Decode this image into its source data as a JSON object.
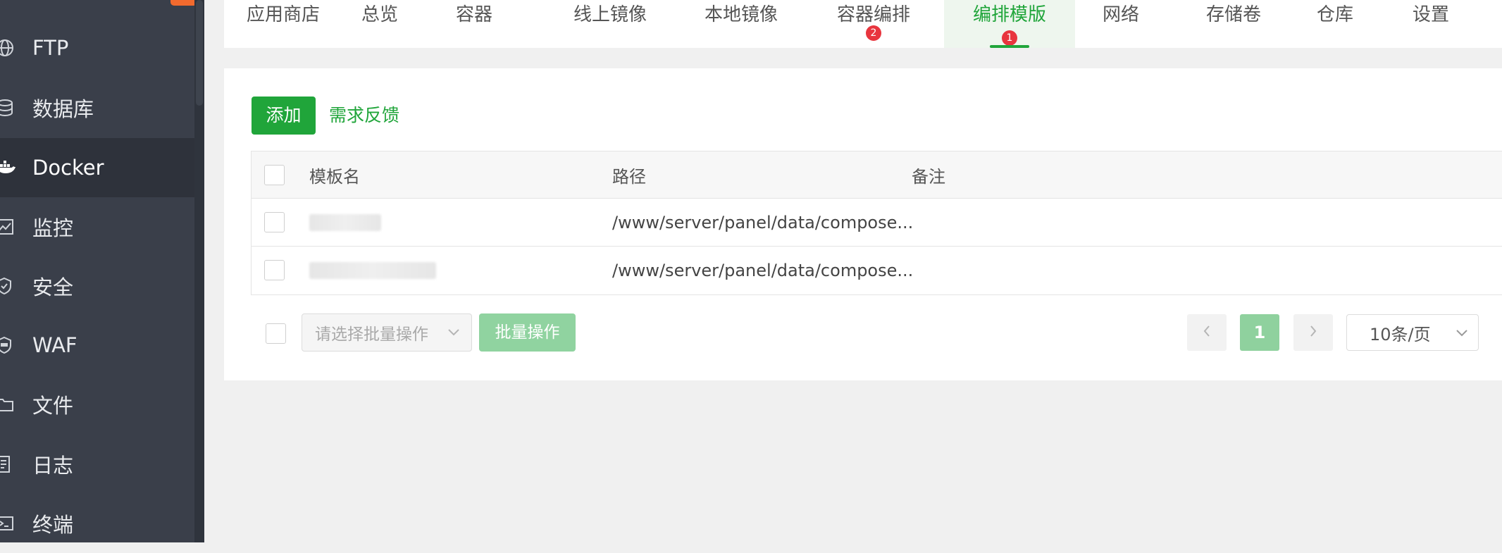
{
  "sidebar": {
    "items": [
      {
        "label": "FTP",
        "icon": "globe-icon"
      },
      {
        "label": "数据库",
        "icon": "database-icon"
      },
      {
        "label": "Docker",
        "icon": "docker-icon",
        "active": true
      },
      {
        "label": "监控",
        "icon": "monitor-chart-icon"
      },
      {
        "label": "安全",
        "icon": "shield-icon"
      },
      {
        "label": "WAF",
        "icon": "waf-shield-icon"
      },
      {
        "label": "文件",
        "icon": "folder-icon"
      },
      {
        "label": "日志",
        "icon": "log-icon"
      },
      {
        "label": "终端",
        "icon": "terminal-icon"
      }
    ]
  },
  "tabs": [
    {
      "label": "应用商店"
    },
    {
      "label": "总览"
    },
    {
      "label": "容器"
    },
    {
      "label": "线上镜像"
    },
    {
      "label": "本地镜像"
    },
    {
      "label": "容器编排",
      "badge": "2"
    },
    {
      "label": "编排模版",
      "badge": "1",
      "active": true
    },
    {
      "label": "网络"
    },
    {
      "label": "存储卷"
    },
    {
      "label": "仓库"
    },
    {
      "label": "设置"
    }
  ],
  "toolbar": {
    "add_label": "添加",
    "feedback_label": "需求反馈"
  },
  "table": {
    "columns": [
      "模板名",
      "路径",
      "备注"
    ],
    "rows": [
      {
        "name": "",
        "path": "/www/server/panel/data/compose...",
        "remark": ""
      },
      {
        "name": "",
        "path": "/www/server/panel/data/compose...",
        "remark": ""
      }
    ]
  },
  "footer": {
    "batch_placeholder": "请选择批量操作",
    "batch_button": "批量操作",
    "current_page": "1",
    "page_size": "10条/页"
  },
  "colors": {
    "accent": "#20a53a",
    "sidebar_bg": "#3a3f4a",
    "badge": "#e8353e"
  }
}
